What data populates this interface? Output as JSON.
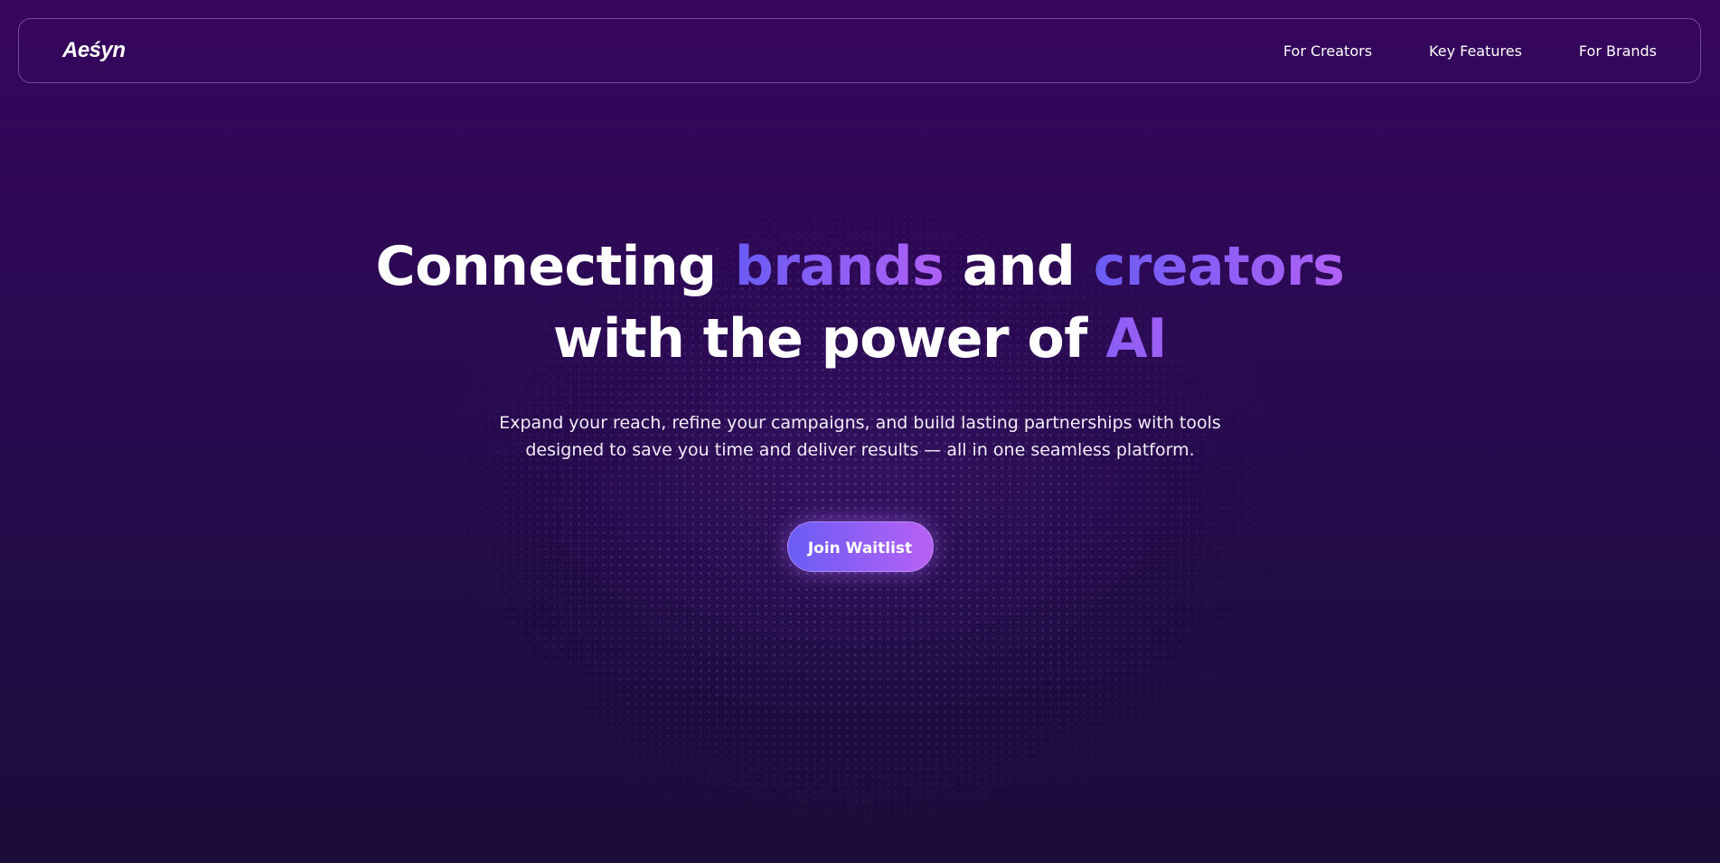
{
  "header": {
    "logo": "Aeśyn",
    "nav": [
      {
        "label": "For Creators"
      },
      {
        "label": "Key Features"
      },
      {
        "label": "For Brands"
      }
    ]
  },
  "hero": {
    "headline": {
      "part1": "Connecting ",
      "highlight1": "brands",
      "part2": " and ",
      "highlight2": "creators",
      "part3": "with the power of ",
      "highlight3": "AI"
    },
    "subtitle": "Expand your reach, refine your campaigns, and build lasting partnerships with tools designed to save you time and deliver results — all in one seamless platform.",
    "cta_label": "Join Waitlist"
  },
  "colors": {
    "background_top": "#36065d",
    "background_bottom": "#1b0c3a",
    "accent_start": "#6a5cf5",
    "accent_end": "#b861f3",
    "text": "#ffffff"
  }
}
